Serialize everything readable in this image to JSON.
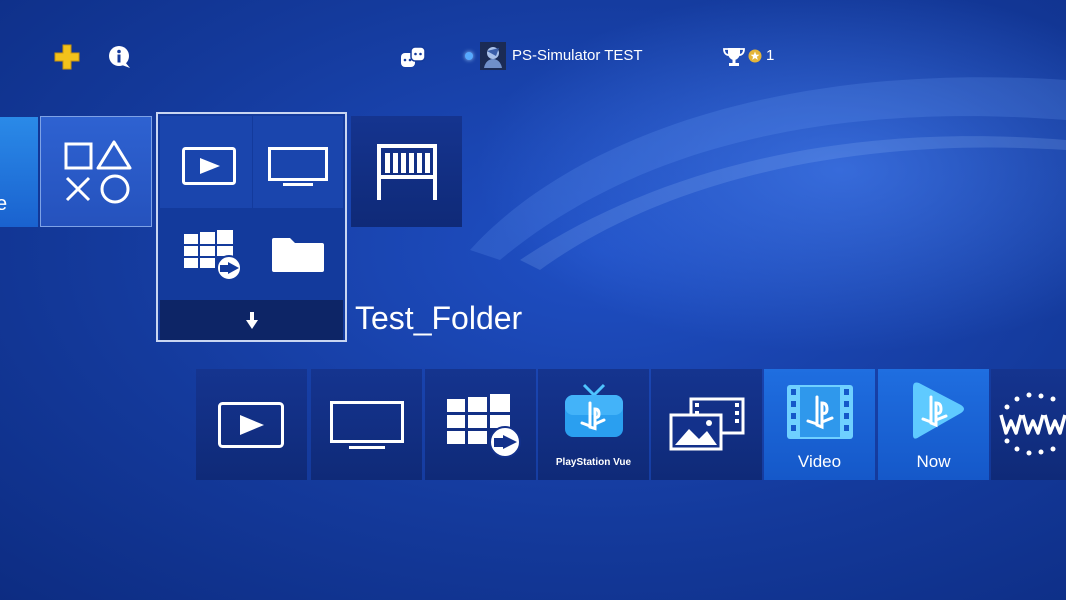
{
  "header": {
    "user_name": "PS-Simulator TEST",
    "trophy_count": "1",
    "icons": [
      "plus-icon",
      "info-icon",
      "friends-icon",
      "online-dot",
      "avatar",
      "trophy-icon",
      "star-icon"
    ]
  },
  "top_row": {
    "partial_tile_fragment": "e",
    "library_icon": "shapes-icon",
    "folder": {
      "name": "Test_Folder",
      "items": [
        "play-icon",
        "tv-icon",
        "grid-share-icon",
        "folder-icon"
      ],
      "expand_icon": "arrow-down-icon"
    },
    "shelf_icon": "shelf-icon"
  },
  "bottom_row": {
    "tiles": [
      {
        "id": "play",
        "icon": "play-icon"
      },
      {
        "id": "tv",
        "icon": "tv-icon"
      },
      {
        "id": "grid-share",
        "icon": "grid-share-icon"
      },
      {
        "id": "playstation-vue",
        "icon": "ps-tv-icon",
        "label": "PlayStation Vue"
      },
      {
        "id": "gallery",
        "icon": "photo-film-icon"
      },
      {
        "id": "video",
        "icon": "ps-film-icon",
        "label": "Video"
      },
      {
        "id": "now",
        "icon": "ps-play-icon",
        "label": "Now"
      },
      {
        "id": "browser",
        "icon": "www-icon"
      }
    ]
  },
  "colors": {
    "background": "#143a9c",
    "tile_dark": "#15348f",
    "tile_blue": "#1f6ee0",
    "focus_border": "#c9d6f2",
    "plus_yellow": "#f2c21b",
    "online_dot": "#56a9ff"
  }
}
